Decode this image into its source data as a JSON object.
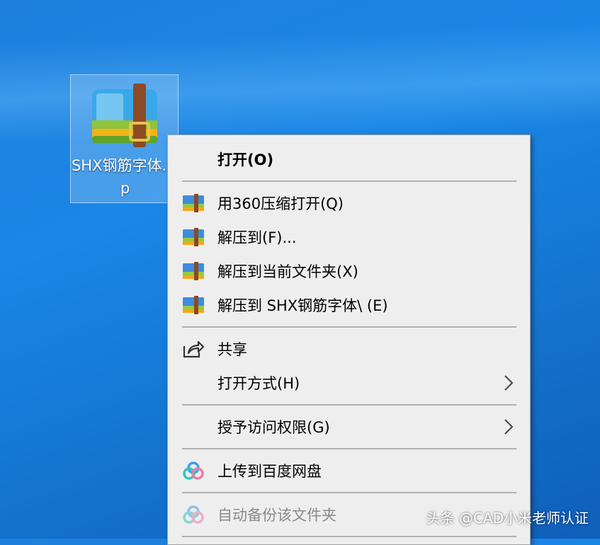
{
  "desktop": {
    "file_icon": {
      "name": "SHX钢筋字体.zip",
      "icon": "winrar-archive-icon"
    }
  },
  "context_menu": {
    "items": [
      {
        "label": "打开(O)",
        "icon": "",
        "bold": true
      },
      {
        "label": "用360压缩打开(Q)",
        "icon": "archive-icon"
      },
      {
        "label": "解压到(F)...",
        "icon": "archive-icon"
      },
      {
        "label": "解压到当前文件夹(X)",
        "icon": "archive-icon"
      },
      {
        "label": "解压到 SHX钢筋字体\\ (E)",
        "icon": "archive-icon"
      },
      {
        "label": "共享",
        "icon": "share-icon"
      },
      {
        "label": "打开方式(H)",
        "icon": "",
        "submenu": true
      },
      {
        "label": "授予访问权限(G)",
        "icon": "",
        "submenu": true
      },
      {
        "label": "上传到百度网盘",
        "icon": "baidu-netdisk-icon"
      },
      {
        "label": "自动备份该文件夹",
        "icon": "baidu-netdisk-icon",
        "disabled": true
      }
    ]
  },
  "watermark": "头条 @CAD小米老师认证",
  "colors": {
    "desktop": "#1a86e6",
    "menu_bg": "#eeeeee",
    "separator": "#b0b0b0"
  }
}
